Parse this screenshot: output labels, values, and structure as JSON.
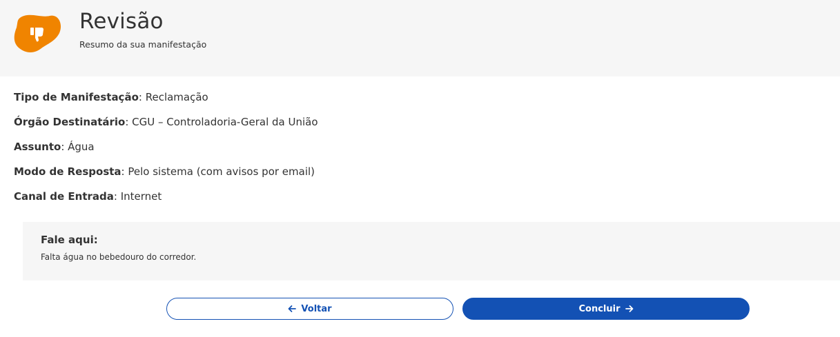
{
  "header": {
    "title": "Revisão",
    "subtitle": "Resumo da sua manifestação",
    "icon": "thumbs-down-icon",
    "icon_color": "#f08400"
  },
  "fields": [
    {
      "key": "Tipo de Manifestação",
      "value": "Reclamação"
    },
    {
      "key": "Órgão Destinatário",
      "value": "CGU – Controladoria-Geral da União"
    },
    {
      "key": "Assunto",
      "value": "Água"
    },
    {
      "key": "Modo de Resposta",
      "value": "Pelo sistema (com avisos por email)"
    },
    {
      "key": "Canal de Entrada",
      "value": "Internet"
    }
  ],
  "fale_aqui": {
    "title": "Fale aqui:",
    "text": "Falta água no bebedouro do corredor."
  },
  "buttons": {
    "back_label": "Voltar",
    "back_icon": "arrow-left-icon",
    "done_label": "Concluir",
    "done_icon": "arrow-right-icon"
  },
  "colors": {
    "accent": "#1351b4",
    "header_bg": "#f6f6f6"
  }
}
